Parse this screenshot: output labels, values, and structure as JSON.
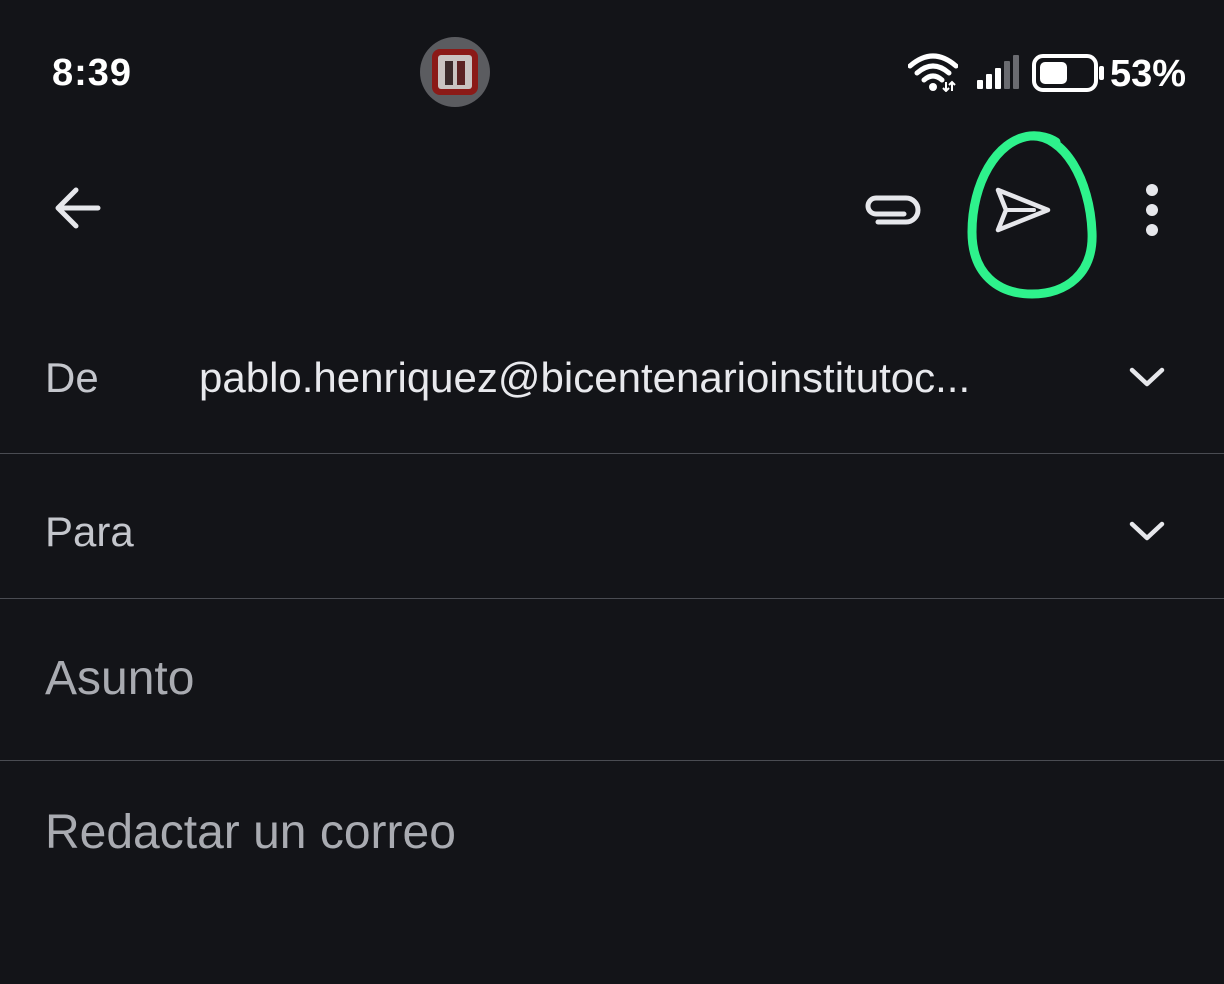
{
  "status_bar": {
    "time": "8:39",
    "battery_percent": "53%",
    "battery_level": 0.53,
    "icons": [
      "notification-bubble-icon",
      "wifi-icon",
      "signal-icon",
      "battery-icon"
    ]
  },
  "toolbar": {
    "icons": [
      "back-arrow-icon",
      "attach-icon",
      "send-icon",
      "more-vert-icon"
    ],
    "highlight_color": "#2ef28c"
  },
  "compose": {
    "from_label": "De",
    "from_value": "pablo.henriquez@bicentenarioinstitutoc...",
    "to_label": "Para",
    "subject_placeholder": "Asunto",
    "body_placeholder": "Redactar un correo"
  },
  "colors": {
    "background": "#131418",
    "divider": "#4a4c52",
    "text": "#e8e9ed",
    "placeholder": "#a9abb1"
  }
}
